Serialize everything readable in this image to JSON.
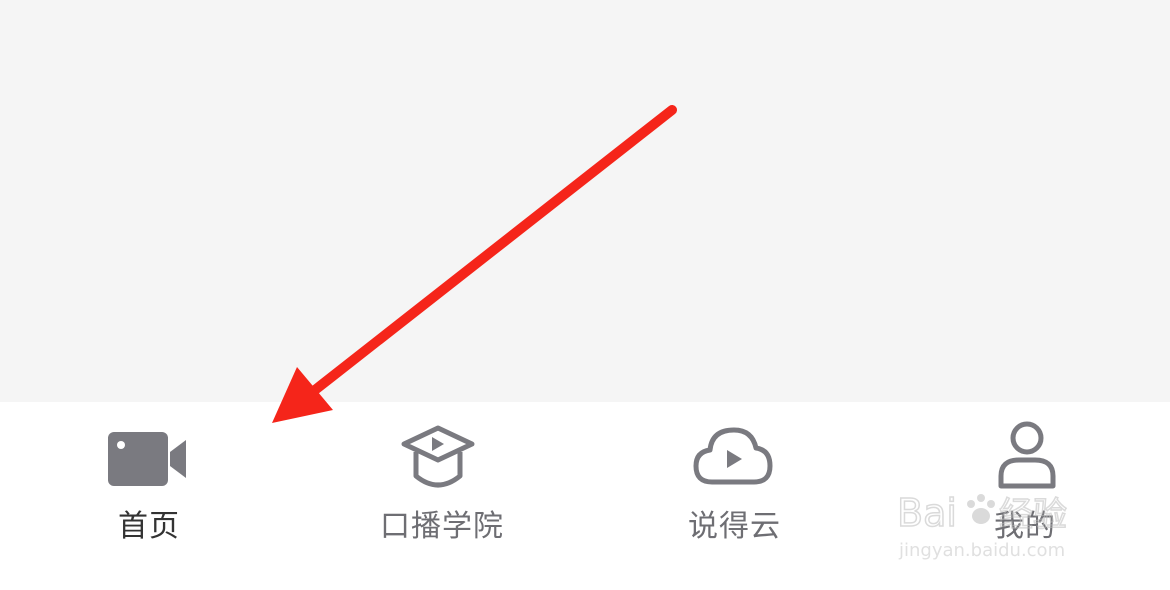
{
  "tabbar": {
    "tabs": [
      {
        "label": "首页",
        "icon": "video-camera-icon",
        "active": true
      },
      {
        "label": "口播学院",
        "icon": "graduation-cap-play-icon",
        "active": false
      },
      {
        "label": "说得云",
        "icon": "cloud-play-icon",
        "active": false
      },
      {
        "label": "我的",
        "icon": "user-icon",
        "active": false
      }
    ]
  },
  "watermark": {
    "brand": "Baidu经验",
    "url": "jingyan.baidu.com"
  },
  "colors": {
    "content_background": "#f5f5f5",
    "tabbar_background": "#ffffff",
    "icon_gray": "#7a7a80",
    "active_label": "#333333",
    "inactive_label": "#6e6e73",
    "annotation_arrow": "#f5251a"
  }
}
